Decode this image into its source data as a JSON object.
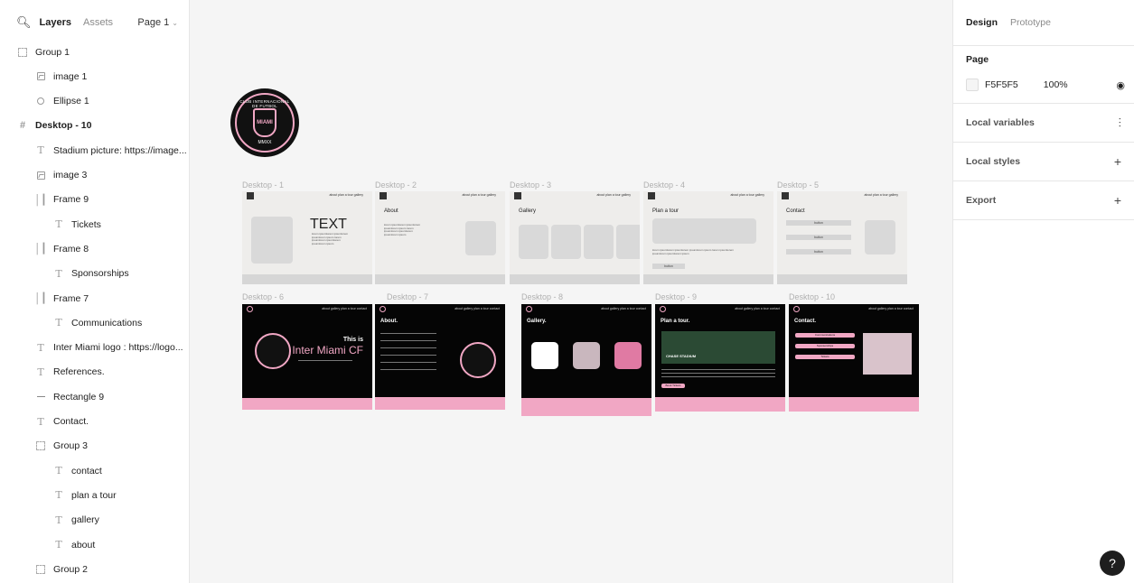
{
  "left_panel": {
    "tabs": {
      "layers": "Layers",
      "assets": "Assets"
    },
    "page_selector": "Page 1",
    "layers": [
      {
        "label": "Group 1",
        "icon": "group-icon",
        "indent": 0,
        "bold": false
      },
      {
        "label": "image 1",
        "icon": "image-icon",
        "indent": 1,
        "bold": false
      },
      {
        "label": "Ellipse 1",
        "icon": "ellipse-icon",
        "indent": 1,
        "bold": false
      },
      {
        "label": "Desktop - 10",
        "icon": "frame-icon",
        "indent": 0,
        "bold": true
      },
      {
        "label": "Stadium picture: https://image...",
        "icon": "text-icon",
        "indent": 1,
        "bold": false
      },
      {
        "label": "image 3",
        "icon": "image-icon",
        "indent": 1,
        "bold": false
      },
      {
        "label": "Frame 9",
        "icon": "autolayout-icon",
        "indent": 1,
        "bold": false
      },
      {
        "label": "Tickets",
        "icon": "text-icon",
        "indent": 2,
        "bold": false
      },
      {
        "label": "Frame 8",
        "icon": "autolayout-icon",
        "indent": 1,
        "bold": false
      },
      {
        "label": "Sponsorships",
        "icon": "text-icon",
        "indent": 2,
        "bold": false
      },
      {
        "label": "Frame 7",
        "icon": "autolayout-icon",
        "indent": 1,
        "bold": false
      },
      {
        "label": "Communications",
        "icon": "text-icon",
        "indent": 2,
        "bold": false
      },
      {
        "label": "Inter Miami logo : https://logo...",
        "icon": "text-icon",
        "indent": 1,
        "bold": false
      },
      {
        "label": "References.",
        "icon": "text-icon",
        "indent": 1,
        "bold": false
      },
      {
        "label": "Rectangle 9",
        "icon": "line-icon",
        "indent": 1,
        "bold": false
      },
      {
        "label": "Contact.",
        "icon": "text-icon",
        "indent": 1,
        "bold": false
      },
      {
        "label": "Group 3",
        "icon": "group-icon",
        "indent": 1,
        "bold": false
      },
      {
        "label": "contact",
        "icon": "text-icon",
        "indent": 2,
        "bold": false
      },
      {
        "label": "plan a tour",
        "icon": "text-icon",
        "indent": 2,
        "bold": false
      },
      {
        "label": "gallery",
        "icon": "text-icon",
        "indent": 2,
        "bold": false
      },
      {
        "label": "about",
        "icon": "text-icon",
        "indent": 2,
        "bold": false
      },
      {
        "label": "Group 2",
        "icon": "group-icon",
        "indent": 1,
        "bold": false
      }
    ]
  },
  "canvas": {
    "background": "#F5F5F5",
    "logo": {
      "top_text": "CLUB INTERNACIONAL DE FUTBOL",
      "shield_text": "MIAMI",
      "bottom_text": "MMXX"
    },
    "wireframes": {
      "nav_links": "about   plan a tour   gallery",
      "f1": {
        "label": "Desktop - 1",
        "heading": "TEXT"
      },
      "f2": {
        "label": "Desktop - 2",
        "heading": "About"
      },
      "f3": {
        "label": "Desktop - 3",
        "heading": "Gallery"
      },
      "f4": {
        "label": "Desktop - 4",
        "heading": "Plan a tour",
        "button": "button"
      },
      "f5": {
        "label": "Desktop - 5",
        "heading": "Contact",
        "buttons": [
          "button",
          "button",
          "button"
        ]
      },
      "lorem": "lorem ipsumlorem ipsumlorem ipsumlorem ipsum lorem ipsumlorem ipsumlorem ipsumlorem ipsum"
    },
    "designs": {
      "nav_links": "about   gallery   plan a tour   contact",
      "d6": {
        "label": "Desktop - 6",
        "title_small": "This is",
        "title_big": "Inter Miami CF"
      },
      "d7": {
        "label": "Desktop - 7",
        "title": "About."
      },
      "d8": {
        "label": "Desktop - 8",
        "title": "Gallery."
      },
      "d9": {
        "label": "Desktop - 9",
        "title": "Plan a tour.",
        "stadium": "CHASE STADIUM",
        "button": "Book Tickets"
      },
      "d10": {
        "label": "Desktop - 10",
        "title": "Contact.",
        "buttons": [
          "Communications",
          "Sponsorships",
          "Tickets"
        ]
      }
    },
    "colors": {
      "pink": "#F1A7C4",
      "dark": "#050505",
      "wire_bg": "#EEEDEB"
    }
  },
  "right_panel": {
    "tabs": {
      "design": "Design",
      "prototype": "Prototype"
    },
    "page": {
      "title": "Page",
      "color": "F5F5F5",
      "opacity": "100%"
    },
    "sections": {
      "local_variables": "Local variables",
      "local_styles": "Local styles",
      "export": "Export"
    }
  },
  "help_label": "?"
}
